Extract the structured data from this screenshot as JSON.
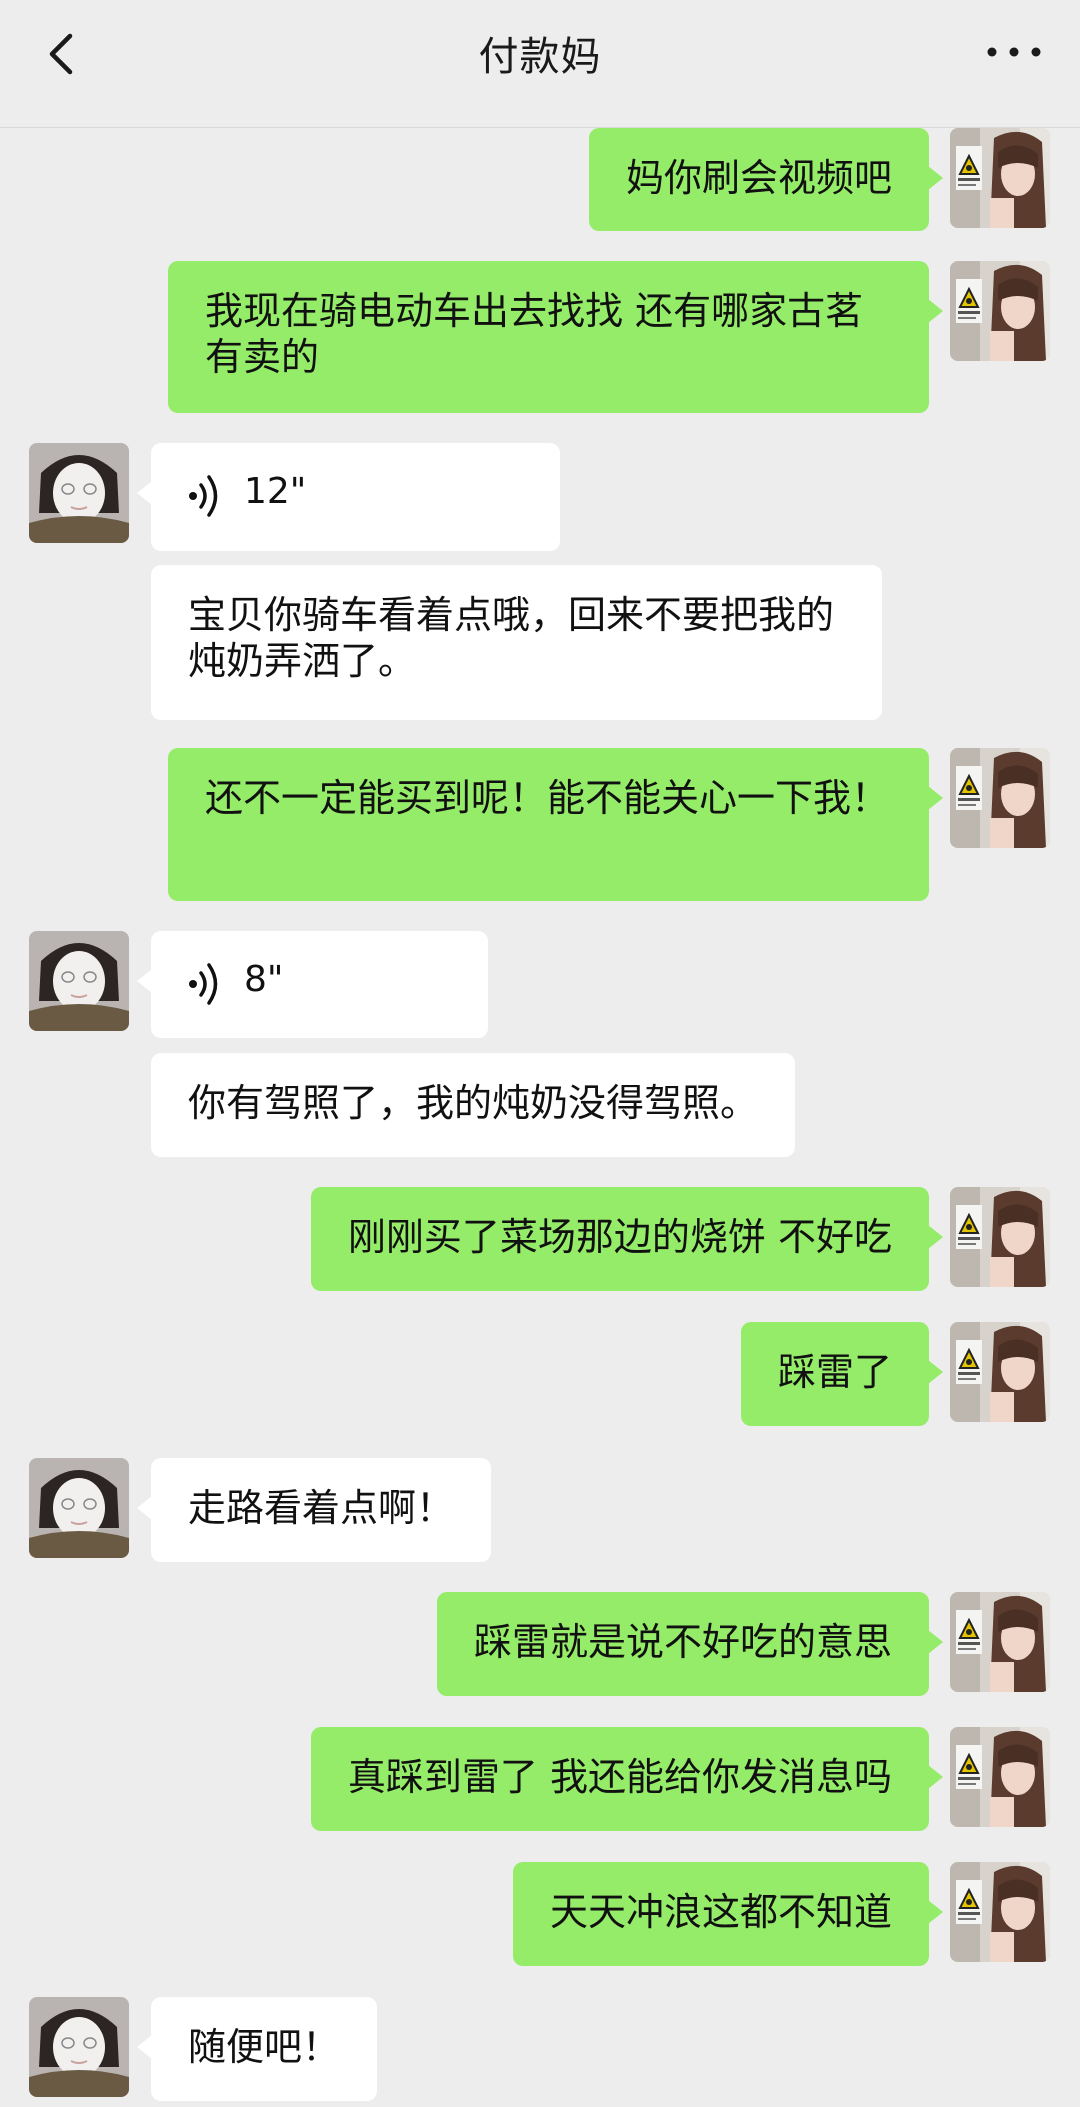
{
  "header": {
    "title": "付款妈"
  },
  "colors": {
    "outgoing_bubble": "#95ec69",
    "incoming_bubble": "#ffffff",
    "background": "#ededed"
  },
  "icons": {
    "back": "chevron-left-icon",
    "more": "more-dots-icon",
    "voice": "voice-wave-icon"
  },
  "messages": [
    {
      "from": "me",
      "type": "text",
      "text": "妈你刷会视频吧"
    },
    {
      "from": "me",
      "type": "text",
      "text": "我现在骑电动车出去找找 还有哪家古茗有卖的"
    },
    {
      "from": "mom",
      "type": "voice",
      "duration": "12\""
    },
    {
      "from": "mom",
      "type": "text",
      "text": "宝贝你骑车看着点哦，回来不要把我的炖奶弄洒了。"
    },
    {
      "from": "me",
      "type": "text",
      "text": "还不一定能买到呢！能不能关心一下我！"
    },
    {
      "from": "mom",
      "type": "voice",
      "duration": "8\""
    },
    {
      "from": "mom",
      "type": "text",
      "text": "你有驾照了，我的炖奶没得驾照。"
    },
    {
      "from": "me",
      "type": "text",
      "text": "刚刚买了菜场那边的烧饼 不好吃"
    },
    {
      "from": "me",
      "type": "text",
      "text": "踩雷了"
    },
    {
      "from": "mom",
      "type": "text",
      "text": "走路看着点啊！"
    },
    {
      "from": "me",
      "type": "text",
      "text": "踩雷就是说不好吃的意思"
    },
    {
      "from": "me",
      "type": "text",
      "text": "真踩到雷了 我还能给你发消息吗"
    },
    {
      "from": "me",
      "type": "text",
      "text": "天天冲浪这都不知道"
    },
    {
      "from": "mom",
      "type": "text",
      "text": "随便吧！"
    }
  ]
}
